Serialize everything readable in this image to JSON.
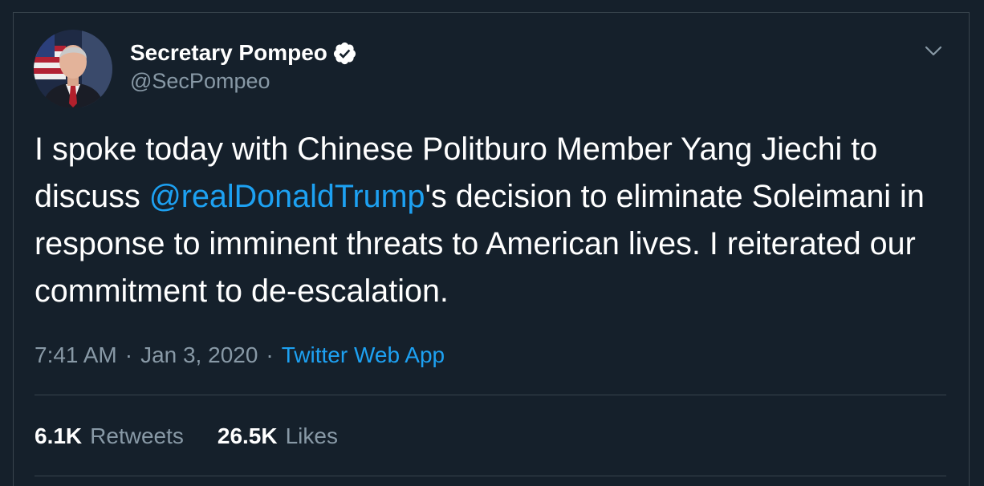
{
  "tweet": {
    "author": {
      "display_name": "Secretary Pompeo",
      "handle": "@SecPompeo",
      "verified_icon": "verified-badge-icon"
    },
    "menu_icon": "chevron-down-icon",
    "text_before_mention": "I spoke today with Chinese Politburo Member Yang Jiechi to discuss ",
    "mention": "@realDonaldTrump",
    "text_after_mention": "'s decision to eliminate Soleimani in response to imminent threats to American lives.  I reiterated our commitment to de-escalation.",
    "time": "7:41 AM",
    "separator": "·",
    "date": "Jan 3, 2020",
    "source": "Twitter Web App",
    "stats": {
      "retweets_count": "6.1K",
      "retweets_label": "Retweets",
      "likes_count": "26.5K",
      "likes_label": "Likes"
    }
  },
  "colors": {
    "background": "#15202b",
    "text": "#ffffff",
    "secondary_text": "#8899a6",
    "accent": "#1da1f2",
    "border": "#38444d"
  }
}
